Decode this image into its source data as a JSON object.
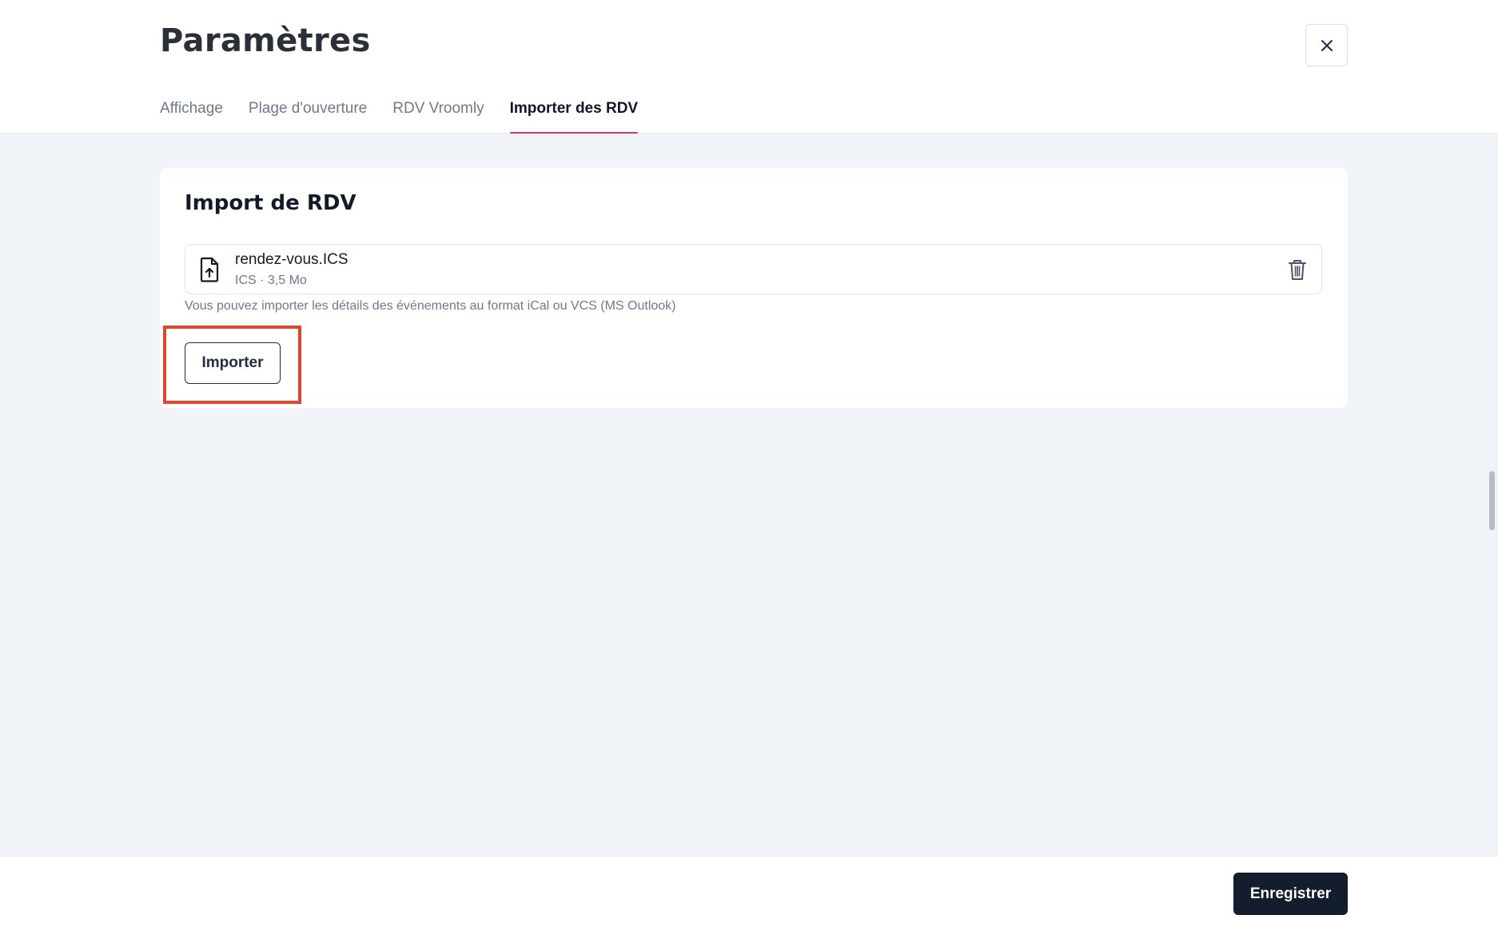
{
  "header": {
    "title": "Paramètres",
    "close_icon": "close-icon",
    "tabs": [
      {
        "label": "Affichage",
        "active": false
      },
      {
        "label": "Plage d'ouverture",
        "active": false
      },
      {
        "label": "RDV Vroomly",
        "active": false
      },
      {
        "label": "Importer des RDV",
        "active": true
      }
    ]
  },
  "import_card": {
    "title": "Import de RDV",
    "file": {
      "icon": "file-upload-icon",
      "name": "rendez-vous.ICS",
      "meta": "ICS · 3,5 Mo",
      "delete_icon": "trash-icon"
    },
    "helper_text": "Vous pouvez importer les détails des événements au format iCal ou VCS (MS Outlook)",
    "import_button_label": "Importer"
  },
  "footer": {
    "save_label": "Enregistrer"
  },
  "colors": {
    "accent_tab_underline": "#d8376e",
    "highlight_box": "#e5432d",
    "primary_button": "#141d2b",
    "background": "#f0f3f8"
  }
}
